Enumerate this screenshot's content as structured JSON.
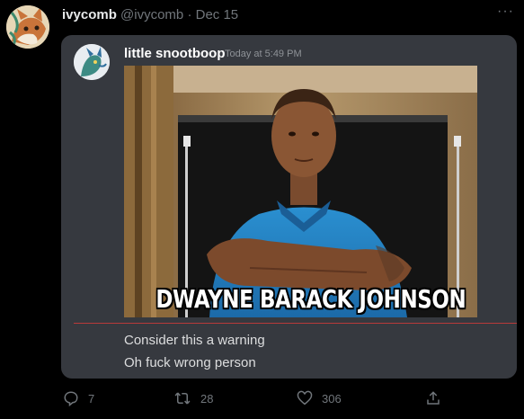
{
  "tweet": {
    "display_name": "ivycomb",
    "handle": "@ivycomb",
    "separator": "·",
    "date": "Dec 15",
    "more_label": "···"
  },
  "discord": {
    "username": "little snootboop",
    "timestamp": "Today at 5:49 PM",
    "meme_caption": "DWAYNE BARACK JOHNSON",
    "messages": [
      "Consider this a warning",
      "Oh fuck wrong person"
    ]
  },
  "actions": {
    "replies": "7",
    "retweets": "28",
    "likes": "306"
  },
  "colors": {
    "background": "#000000",
    "embed_bg": "#36393f",
    "divider": "#b83a3a",
    "muted": "#71767b"
  }
}
